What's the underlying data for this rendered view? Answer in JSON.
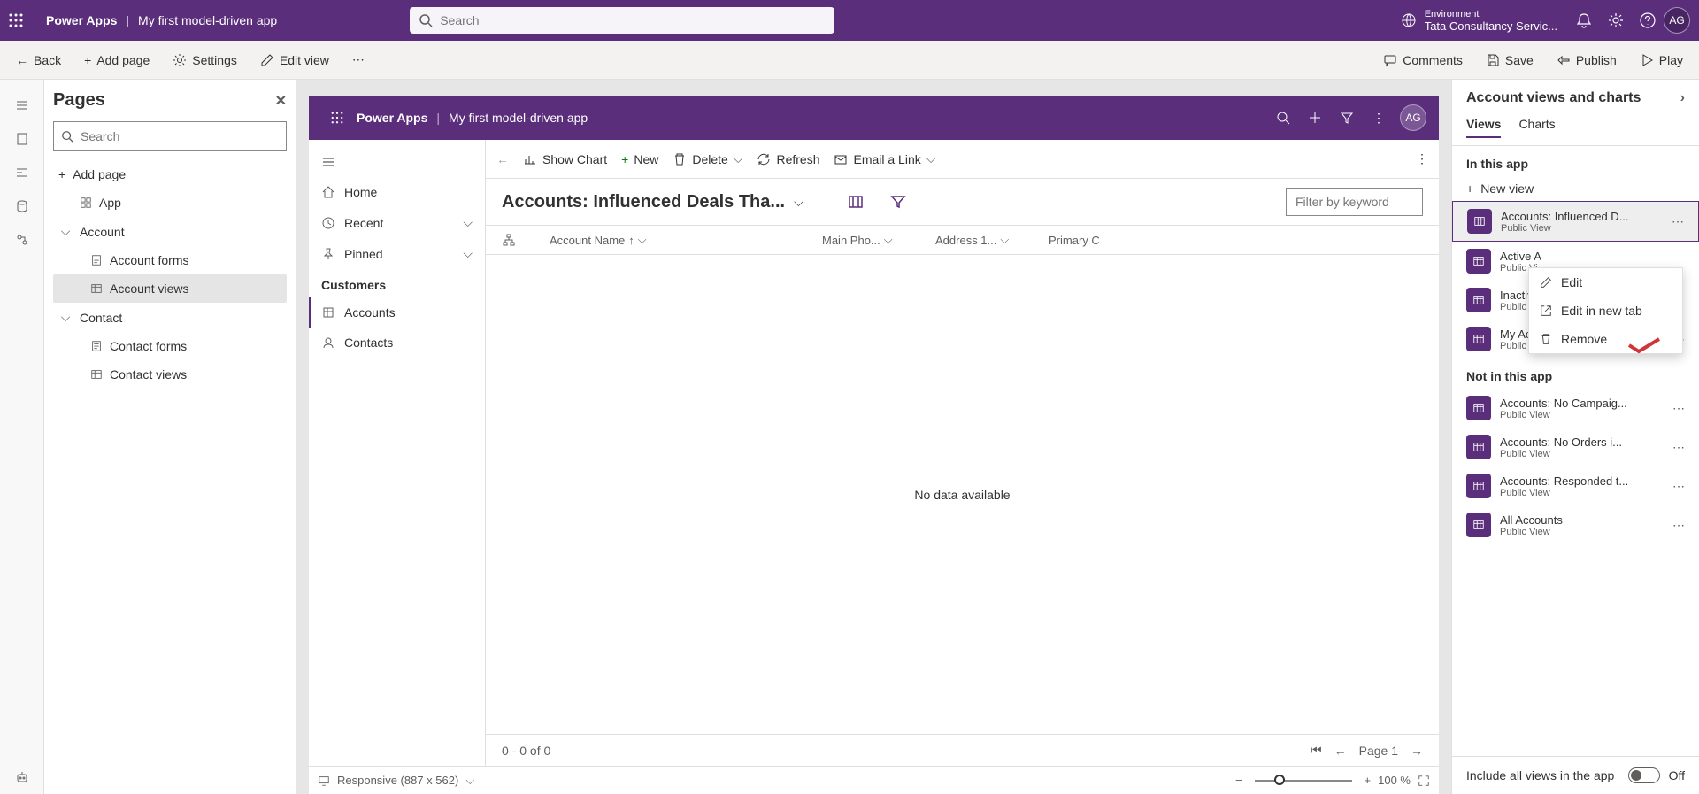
{
  "header": {
    "product": "Power Apps",
    "app_name": "My first model-driven app",
    "search_placeholder": "Search",
    "environment_label": "Environment",
    "environment_name": "Tata Consultancy Servic...",
    "avatar": "AG"
  },
  "cmdbar": {
    "back": "Back",
    "add_page": "Add page",
    "settings": "Settings",
    "edit_view": "Edit view",
    "comments": "Comments",
    "save": "Save",
    "publish": "Publish",
    "play": "Play"
  },
  "pages": {
    "title": "Pages",
    "search_placeholder": "Search",
    "add_page": "Add page",
    "items": [
      {
        "label": "App"
      },
      {
        "label": "Account"
      },
      {
        "label": "Account forms"
      },
      {
        "label": "Account views"
      },
      {
        "label": "Contact"
      },
      {
        "label": "Contact forms"
      },
      {
        "label": "Contact views"
      }
    ]
  },
  "canvas": {
    "product": "Power Apps",
    "app_name": "My first model-driven app",
    "avatar": "AG",
    "nav": {
      "home": "Home",
      "recent": "Recent",
      "pinned": "Pinned",
      "group": "Customers",
      "accounts": "Accounts",
      "contacts": "Contacts"
    },
    "cmdbar": {
      "show_chart": "Show Chart",
      "new": "New",
      "delete": "Delete",
      "refresh": "Refresh",
      "email_link": "Email a Link"
    },
    "view_title": "Accounts: Influenced Deals Tha...",
    "filter_placeholder": "Filter by keyword",
    "columns": {
      "account_name": "Account Name",
      "main_phone": "Main Pho...",
      "address": "Address 1...",
      "contact": "Primary C"
    },
    "no_data": "No data available",
    "pager": {
      "count": "0 - 0 of 0",
      "page": "Page 1"
    },
    "footer": {
      "responsive": "Responsive (887 x 562)",
      "zoom": "100 %"
    }
  },
  "right": {
    "title": "Account views and charts",
    "tabs": {
      "views": "Views",
      "charts": "Charts"
    },
    "in_app": "In this app",
    "new_view": "New view",
    "not_in_app": "Not in this app",
    "include_all": "Include all views in the app",
    "toggle_label": "Off",
    "views_in": [
      {
        "title": "Accounts: Influenced D...",
        "sub": "Public View"
      },
      {
        "title": "Active A",
        "sub": "Public Vi"
      },
      {
        "title": "Inactive",
        "sub": "Public Vi"
      },
      {
        "title": "My Active Accounts",
        "sub": "Public View (Default)"
      }
    ],
    "views_out": [
      {
        "title": "Accounts: No Campaig...",
        "sub": "Public View"
      },
      {
        "title": "Accounts: No Orders i...",
        "sub": "Public View"
      },
      {
        "title": "Accounts: Responded t...",
        "sub": "Public View"
      },
      {
        "title": "All Accounts",
        "sub": "Public View"
      }
    ]
  },
  "context_menu": {
    "edit": "Edit",
    "edit_tab": "Edit in new tab",
    "remove": "Remove"
  }
}
